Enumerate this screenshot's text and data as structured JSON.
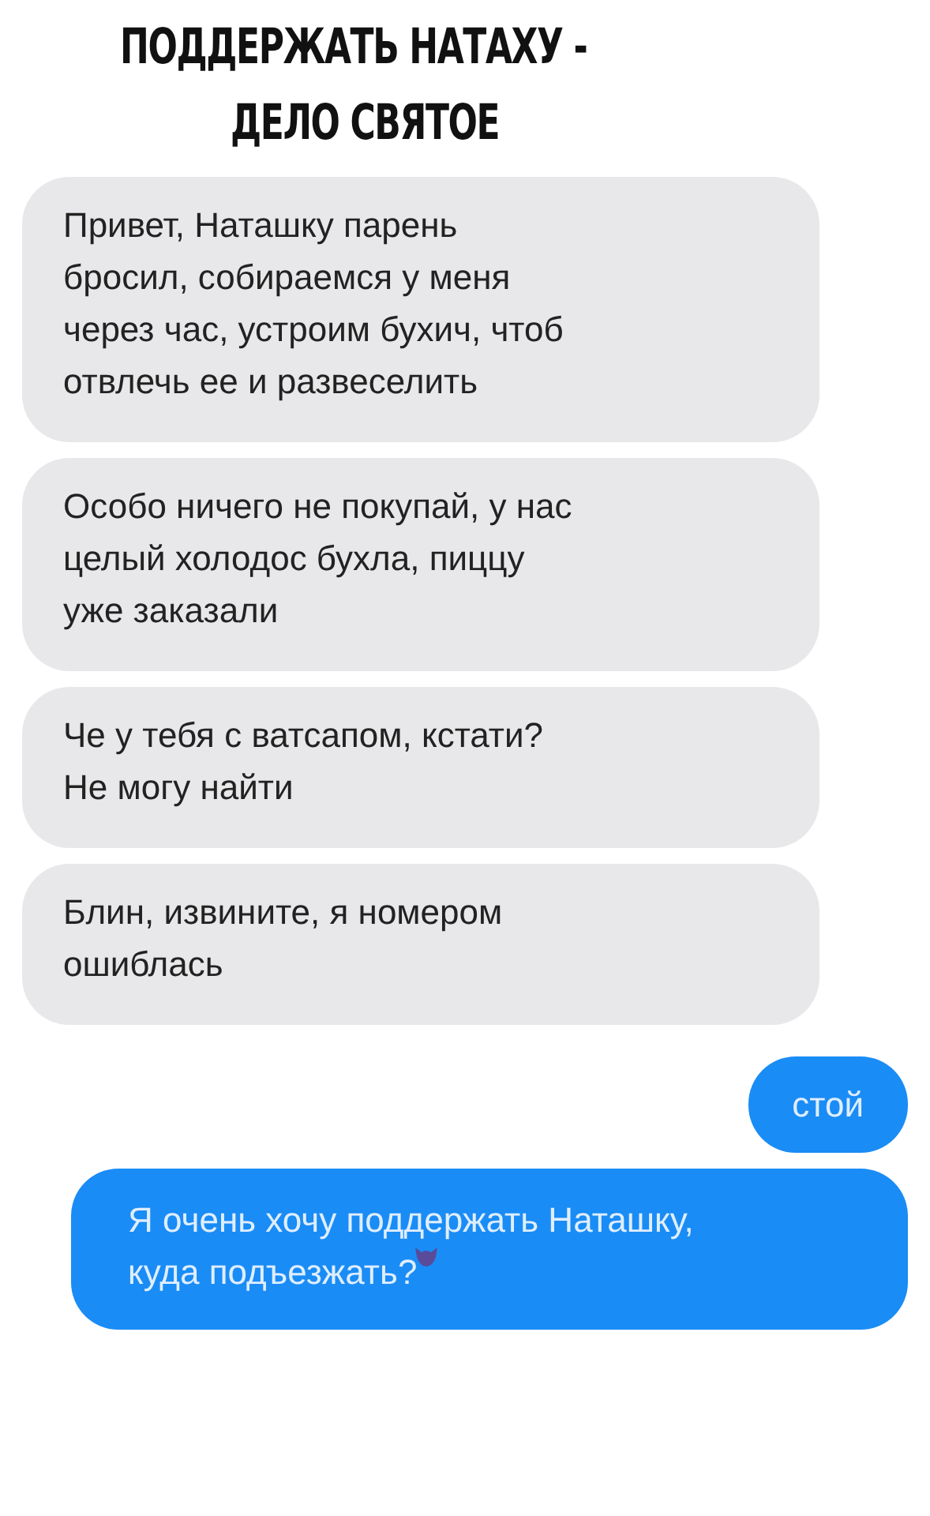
{
  "caption": [
    "ПОДДЕРЖАТЬ НАТАХУ -",
    "ДЕЛО СВЯТОЕ"
  ],
  "messages": [
    {
      "kind": "received",
      "text": "Привет, Наташку парень бросил, собираемся у меня через час, устроим бухич, чтоб отвлечь ее и развеселить"
    },
    {
      "kind": "received",
      "text": "Особо ничего не покупай, у нас целый холодос бухла, пиццу уже заказали"
    },
    {
      "kind": "received",
      "text": "Че у тебя с ватсапом, кстати? Не могу найти"
    },
    {
      "kind": "received",
      "text": "Блин, извините, я номером ошиблась"
    },
    {
      "kind": "sent",
      "text": "стой"
    },
    {
      "kind": "sent",
      "text": "Я очень хочу поддержать Наташку, куда подъезжать?",
      "emoji": true
    }
  ]
}
